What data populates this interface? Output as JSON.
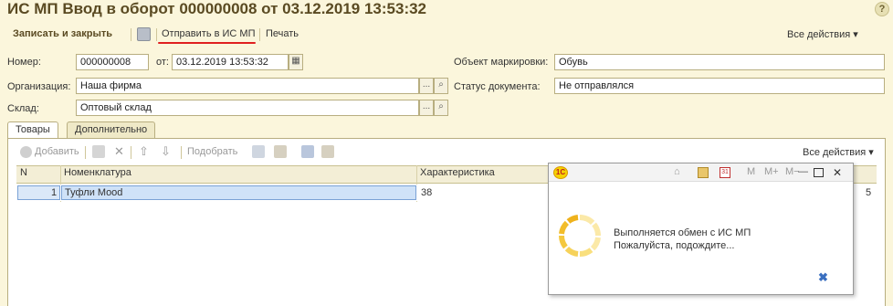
{
  "window": {
    "title": "ИС МП Ввод в оборот 000000008 от 03.12.2019 13:53:32",
    "help_label": "?"
  },
  "toolbar": {
    "save_close": "Записать и закрыть",
    "send": "Отправить в ИС МП",
    "print": "Печать",
    "all_actions": "Все действия"
  },
  "form": {
    "number_label": "Номер:",
    "number_value": "000000008",
    "date_label": "от:",
    "date_value": "03.12.2019 13:53:32",
    "object_label": "Объект маркировки:",
    "object_value": "Обувь",
    "org_label": "Организация:",
    "org_value": "Наша фирма",
    "status_label": "Статус документа:",
    "status_value": "Не отправлялся",
    "warehouse_label": "Склад:",
    "warehouse_value": "Оптовый склад",
    "dots": "..."
  },
  "tabs": [
    {
      "label": "Товары",
      "active": true
    },
    {
      "label": "Дополнительно",
      "active": false
    }
  ],
  "table_toolbar": {
    "add": "Добавить",
    "pick": "Подобрать",
    "all_actions": "Все действия"
  },
  "table": {
    "headers": [
      "N",
      "Номенклатура",
      "Характеристика"
    ],
    "rows": [
      {
        "n": "1",
        "item": "Туфли  Mood",
        "characteristic": "38",
        "last": "5"
      }
    ]
  },
  "popup": {
    "logo": "1С",
    "m": "M",
    "mplus": "M+",
    "mminus": "M−",
    "message_line1": "Выполняется обмен с ИС МП",
    "message_line2": "Пожалуйста, подождите..."
  }
}
